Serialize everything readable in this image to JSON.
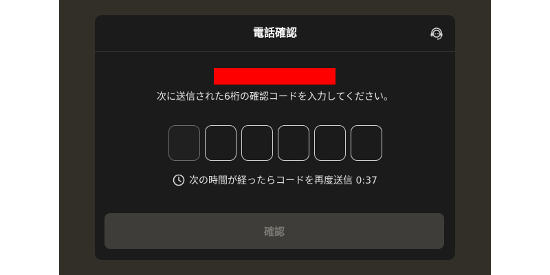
{
  "modal": {
    "title": "電話確認",
    "support_icon": "headset-icon"
  },
  "instruction": "次に送信された6桁の確認コードを入力してください。",
  "code_input": {
    "length": 6,
    "values": [
      "",
      "",
      "",
      "",
      "",
      ""
    ],
    "active_index": 0
  },
  "timer": {
    "icon": "clock-icon",
    "text": "次の時間が経ったらコードを再度送信 0:37"
  },
  "confirm_button": {
    "label": "確認",
    "disabled": true
  },
  "colors": {
    "backdrop": "#322f28",
    "modal_bg": "#1b1b1b",
    "redaction": "#ff0000",
    "button_bg": "#3e3d3a",
    "button_text": "#7a7872"
  }
}
